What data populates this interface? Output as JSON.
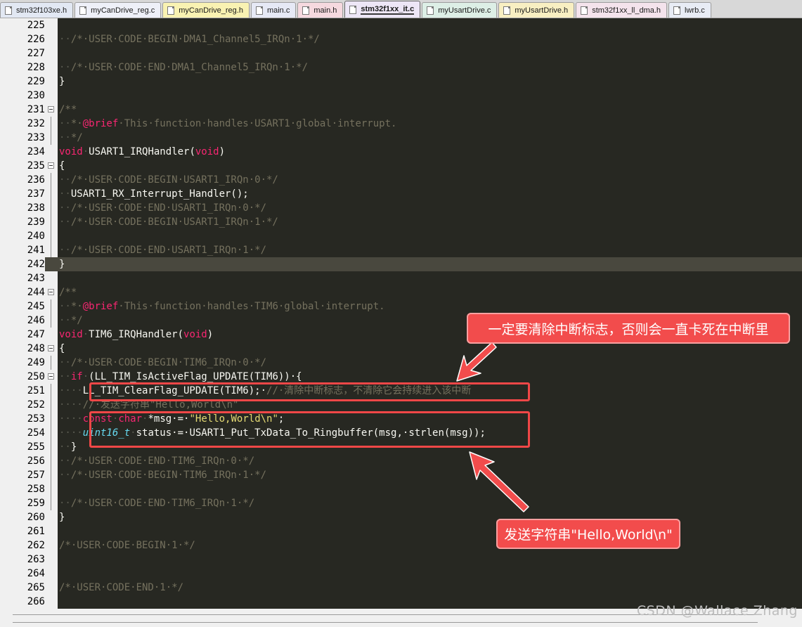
{
  "tabs": [
    {
      "label": "stm32f103xe.h",
      "color": "#e2e8f3",
      "active": false
    },
    {
      "label": "myCanDrive_reg.c",
      "color": "#eef0f8",
      "active": false
    },
    {
      "label": "myCanDrive_reg.h",
      "color": "#f9f2b2",
      "active": false
    },
    {
      "label": "main.c",
      "color": "#e6e9f5",
      "active": false
    },
    {
      "label": "main.h",
      "color": "#f6d9df",
      "active": false
    },
    {
      "label": "stm32f1xx_it.c",
      "color": "#ede6f6",
      "active": true
    },
    {
      "label": "myUsartDrive.c",
      "color": "#ddefe6",
      "active": false
    },
    {
      "label": "myUsartDrive.h",
      "color": "#f8efc2",
      "active": false
    },
    {
      "label": "stm32f1xx_ll_dma.h",
      "color": "#f4e3ec",
      "active": false
    },
    {
      "label": "lwrb.c",
      "color": "#e8ecf5",
      "active": false
    }
  ],
  "code_lines": [
    {
      "n": "225",
      "segs": []
    },
    {
      "n": "226",
      "segs": [
        [
          "dt",
          "··"
        ],
        [
          "cm",
          "/*·USER·CODE·BEGIN·DMA1_Channel5_IRQn·1·*/"
        ]
      ]
    },
    {
      "n": "227",
      "segs": []
    },
    {
      "n": "228",
      "segs": [
        [
          "dt",
          "··"
        ],
        [
          "cm",
          "/*·USER·CODE·END·DMA1_Channel5_IRQn·1·*/"
        ]
      ]
    },
    {
      "n": "229",
      "segs": [
        [
          "",
          "}"
        ]
      ]
    },
    {
      "n": "230",
      "segs": []
    },
    {
      "n": "231",
      "fold": "box",
      "segs": [
        [
          "cm",
          "/**"
        ]
      ]
    },
    {
      "n": "232",
      "fold": "line",
      "segs": [
        [
          "dt",
          "··"
        ],
        [
          "cm",
          "*·"
        ],
        [
          "at",
          "@brief"
        ],
        [
          "cm",
          "·This·function·handles·USART1·global·interrupt."
        ]
      ]
    },
    {
      "n": "233",
      "fold": "line",
      "segs": [
        [
          "dt",
          "··"
        ],
        [
          "cm",
          "*/"
        ]
      ]
    },
    {
      "n": "234",
      "segs": [
        [
          "kw",
          "void"
        ],
        [
          "dt",
          "·"
        ],
        [
          "",
          "USART1_IRQHandler("
        ],
        [
          "kw",
          "void"
        ],
        [
          "",
          ")"
        ]
      ]
    },
    {
      "n": "235",
      "fold": "box",
      "segs": [
        [
          "",
          "{"
        ]
      ]
    },
    {
      "n": "236",
      "fold": "line",
      "segs": [
        [
          "dt",
          "··"
        ],
        [
          "cm",
          "/*·USER·CODE·BEGIN·USART1_IRQn·0·*/"
        ]
      ]
    },
    {
      "n": "237",
      "fold": "line",
      "segs": [
        [
          "dt",
          "··"
        ],
        [
          "",
          "USART1_RX_Interrupt_Handler();"
        ]
      ]
    },
    {
      "n": "238",
      "fold": "line",
      "segs": [
        [
          "dt",
          "··"
        ],
        [
          "cm",
          "/*·USER·CODE·END·USART1_IRQn·0·*/"
        ]
      ]
    },
    {
      "n": "239",
      "fold": "line",
      "segs": [
        [
          "dt",
          "··"
        ],
        [
          "cm",
          "/*·USER·CODE·BEGIN·USART1_IRQn·1·*/"
        ]
      ]
    },
    {
      "n": "240",
      "fold": "line",
      "segs": []
    },
    {
      "n": "241",
      "fold": "line",
      "segs": [
        [
          "dt",
          "··"
        ],
        [
          "cm",
          "/*·USER·CODE·END·USART1_IRQn·1·*/"
        ]
      ]
    },
    {
      "n": "242",
      "current": true,
      "segs": [
        [
          "",
          "}"
        ]
      ]
    },
    {
      "n": "243",
      "segs": []
    },
    {
      "n": "244",
      "fold": "box",
      "segs": [
        [
          "cm",
          "/**"
        ]
      ]
    },
    {
      "n": "245",
      "fold": "line",
      "segs": [
        [
          "dt",
          "··"
        ],
        [
          "cm",
          "*·"
        ],
        [
          "at",
          "@brief"
        ],
        [
          "cm",
          "·This·function·handles·TIM6·global·interrupt."
        ]
      ]
    },
    {
      "n": "246",
      "fold": "line",
      "segs": [
        [
          "dt",
          "··"
        ],
        [
          "cm",
          "*/"
        ]
      ]
    },
    {
      "n": "247",
      "segs": [
        [
          "kw",
          "void"
        ],
        [
          "dt",
          "·"
        ],
        [
          "",
          "TIM6_IRQHandler("
        ],
        [
          "kw",
          "void"
        ],
        [
          "",
          ")"
        ]
      ]
    },
    {
      "n": "248",
      "fold": "box",
      "segs": [
        [
          "",
          "{"
        ]
      ]
    },
    {
      "n": "249",
      "fold": "line",
      "segs": [
        [
          "dt",
          "··"
        ],
        [
          "cm",
          "/*·USER·CODE·BEGIN·TIM6_IRQn·0·*/"
        ]
      ]
    },
    {
      "n": "250",
      "fold": "box",
      "segs": [
        [
          "dt",
          "··"
        ],
        [
          "kw",
          "if"
        ],
        [
          "dt",
          "·"
        ],
        [
          "",
          "(LL_TIM_IsActiveFlag_UPDATE(TIM6))·{"
        ]
      ]
    },
    {
      "n": "251",
      "fold": "line",
      "segs": [
        [
          "dt",
          "····"
        ],
        [
          "",
          "LL_TIM_ClearFlag_UPDATE(TIM6);·"
        ],
        [
          "cm",
          "//·清除中断标志，不清除它会持续进入该中断"
        ]
      ]
    },
    {
      "n": "252",
      "fold": "line",
      "segs": [
        [
          "dt",
          "····"
        ],
        [
          "cm",
          "//·发送字符串\"Hello,World\\n\""
        ]
      ]
    },
    {
      "n": "253",
      "fold": "line",
      "segs": [
        [
          "dt",
          "····"
        ],
        [
          "kw",
          "const"
        ],
        [
          "dt",
          "·"
        ],
        [
          "kw",
          "char"
        ],
        [
          "dt",
          "·"
        ],
        [
          "",
          "*msg·=·"
        ],
        [
          "st",
          "\"Hello,World\\n\""
        ],
        [
          "",
          ";"
        ]
      ]
    },
    {
      "n": "254",
      "fold": "line",
      "segs": [
        [
          "dt",
          "····"
        ],
        [
          "ty",
          "uint16_t"
        ],
        [
          "dt",
          "·"
        ],
        [
          "",
          "status·=·USART1_Put_TxData_To_Ringbuffer(msg,·strlen(msg));"
        ]
      ]
    },
    {
      "n": "255",
      "fold": "line",
      "segs": [
        [
          "dt",
          "··"
        ],
        [
          "",
          "}"
        ]
      ]
    },
    {
      "n": "256",
      "fold": "line",
      "segs": [
        [
          "dt",
          "··"
        ],
        [
          "cm",
          "/*·USER·CODE·END·TIM6_IRQn·0·*/"
        ]
      ]
    },
    {
      "n": "257",
      "fold": "line",
      "segs": [
        [
          "dt",
          "··"
        ],
        [
          "cm",
          "/*·USER·CODE·BEGIN·TIM6_IRQn·1·*/"
        ]
      ]
    },
    {
      "n": "258",
      "fold": "line",
      "segs": []
    },
    {
      "n": "259",
      "fold": "line",
      "segs": [
        [
          "dt",
          "··"
        ],
        [
          "cm",
          "/*·USER·CODE·END·TIM6_IRQn·1·*/"
        ]
      ]
    },
    {
      "n": "260",
      "segs": [
        [
          "",
          "}"
        ]
      ]
    },
    {
      "n": "261",
      "segs": []
    },
    {
      "n": "262",
      "segs": [
        [
          "cm",
          "/*·USER·CODE·BEGIN·1·*/"
        ]
      ]
    },
    {
      "n": "263",
      "segs": []
    },
    {
      "n": "264",
      "segs": []
    },
    {
      "n": "265",
      "segs": [
        [
          "cm",
          "/*·USER·CODE·END·1·*/"
        ]
      ]
    },
    {
      "n": "266",
      "segs": []
    }
  ],
  "annotations": {
    "callout_top": "一定要清除中断标志，否则会一直卡死在中断里",
    "callout_bottom": "发送字符串\"Hello,World\\n\"",
    "accent_color": "#f04747"
  },
  "watermark": "CSDN @Wallace Zhang"
}
